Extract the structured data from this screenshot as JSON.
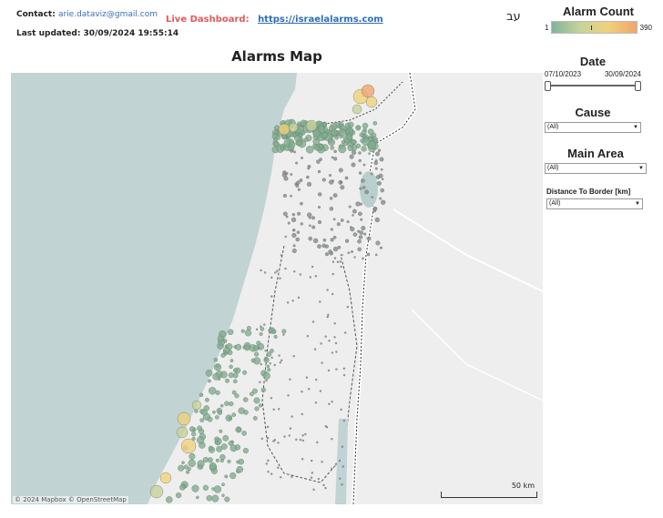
{
  "header": {
    "contact_label": "Contact:",
    "contact_email": "arie.dataviz@gmail.com",
    "last_updated_label": "Last updated: 30/09/2024 19:55:14",
    "live_label": "Live Dashboard:",
    "live_url": "https://israelalarms.com",
    "language_toggle": "עב"
  },
  "map": {
    "title": "Alarms Map",
    "attribution": "© 2024 Mapbox © OpenStreetMap",
    "scale_label": "50 km",
    "marker_colors": {
      "low": "#7fae8e",
      "mid": "#c8d29a",
      "high": "#f0d27a",
      "max": "#f0a56b"
    }
  },
  "filters": {
    "alarm_count": {
      "title": "Alarm Count",
      "min": "1",
      "max": "390"
    },
    "date": {
      "title": "Date",
      "start": "07/10/2023",
      "end": "30/09/2024"
    },
    "cause": {
      "title": "Cause",
      "value": "(All)"
    },
    "main_area": {
      "title": "Main Area",
      "value": "(All)"
    },
    "distance": {
      "title": "Distance To Border [km]",
      "value": "(All)"
    }
  }
}
